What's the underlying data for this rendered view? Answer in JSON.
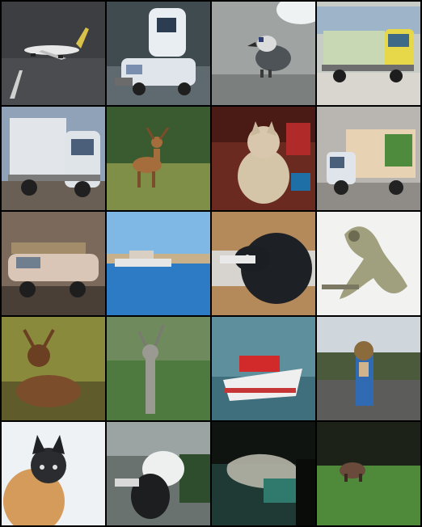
{
  "grid": {
    "rows": 5,
    "columns": 4,
    "tiles": [
      {
        "subject": "airplane",
        "bg": [
          "#3a3c40",
          "#585a5e"
        ]
      },
      {
        "subject": "car",
        "bg": [
          "#3d4a52",
          "#6e7880"
        ]
      },
      {
        "subject": "bird",
        "bg": [
          "#a5a8a6",
          "#6d716f"
        ]
      },
      {
        "subject": "truck",
        "bg": [
          "#c8ccc4",
          "#d9d6cc"
        ]
      },
      {
        "subject": "truck",
        "bg": [
          "#8fa1b8",
          "#6a5f55"
        ]
      },
      {
        "subject": "deer",
        "bg": [
          "#2f4a28",
          "#7c8a45"
        ]
      },
      {
        "subject": "cat",
        "bg": [
          "#5a2318",
          "#7c3b2b"
        ]
      },
      {
        "subject": "truck",
        "bg": [
          "#b9b6b1",
          "#8e8a85"
        ]
      },
      {
        "subject": "car",
        "bg": [
          "#7d6a5c",
          "#4a3e36"
        ]
      },
      {
        "subject": "ship",
        "bg": [
          "#7fb6e3",
          "#2f7bc2"
        ]
      },
      {
        "subject": "dog",
        "bg": [
          "#b58a5b",
          "#d9d6d1"
        ]
      },
      {
        "subject": "dog",
        "bg": [
          "#f2f2f0",
          "#e6e4df"
        ]
      },
      {
        "subject": "deer",
        "bg": [
          "#8a8b3a",
          "#5d5a28"
        ]
      },
      {
        "subject": "deer",
        "bg": [
          "#6f8a5c",
          "#4e7a3e"
        ]
      },
      {
        "subject": "ship",
        "bg": [
          "#5e8f9c",
          "#3f6e7c"
        ]
      },
      {
        "subject": "frog",
        "bg": [
          "#cfd6dc",
          "#4a5a3a"
        ]
      },
      {
        "subject": "cat",
        "bg": [
          "#eef2f4",
          "#d9dde0"
        ]
      },
      {
        "subject": "dog",
        "bg": [
          "#6a7270",
          "#3a4240"
        ]
      },
      {
        "subject": "frog",
        "bg": [
          "#0f1410",
          "#1f3a34"
        ]
      },
      {
        "subject": "deer",
        "bg": [
          "#1a1f15",
          "#4f8a3a"
        ]
      }
    ]
  }
}
